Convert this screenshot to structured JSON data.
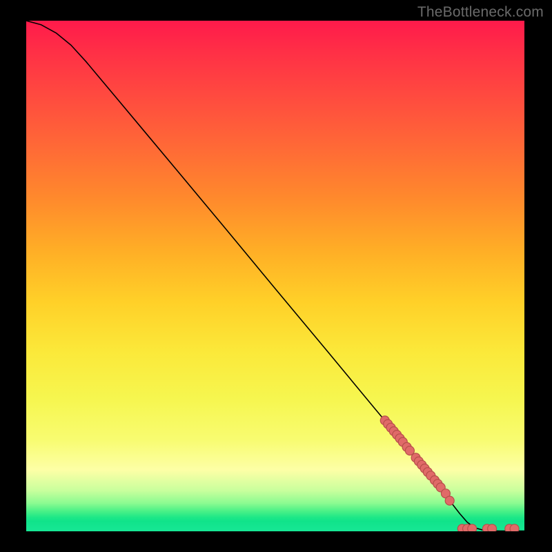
{
  "attribution": "TheBottleneck.com",
  "chart_data": {
    "type": "line",
    "title": "",
    "xlabel": "",
    "ylabel": "",
    "xlim": [
      0,
      100
    ],
    "ylim": [
      0,
      100
    ],
    "grid": false,
    "legend": false,
    "curve": [
      {
        "x": 0,
        "y": 100
      },
      {
        "x": 3,
        "y": 99.2
      },
      {
        "x": 6,
        "y": 97.6
      },
      {
        "x": 9,
        "y": 95.2
      },
      {
        "x": 12,
        "y": 92.0
      },
      {
        "x": 15,
        "y": 88.5
      },
      {
        "x": 18,
        "y": 85.0
      },
      {
        "x": 24,
        "y": 78.0
      },
      {
        "x": 30,
        "y": 71.0
      },
      {
        "x": 40,
        "y": 59.3
      },
      {
        "x": 50,
        "y": 47.5
      },
      {
        "x": 60,
        "y": 35.8
      },
      {
        "x": 70,
        "y": 24.0
      },
      {
        "x": 76,
        "y": 17.0
      },
      {
        "x": 80,
        "y": 12.3
      },
      {
        "x": 83,
        "y": 8.8
      },
      {
        "x": 85,
        "y": 6.0
      },
      {
        "x": 87,
        "y": 3.5
      },
      {
        "x": 88.5,
        "y": 1.8
      },
      {
        "x": 90,
        "y": 0.7
      },
      {
        "x": 92,
        "y": 0.15
      },
      {
        "x": 95,
        "y": 0.05
      },
      {
        "x": 100,
        "y": 0.05
      }
    ],
    "points": [
      {
        "x": 72.0,
        "y": 21.7
      },
      {
        "x": 72.6,
        "y": 21.0
      },
      {
        "x": 73.2,
        "y": 20.3
      },
      {
        "x": 73.8,
        "y": 19.6
      },
      {
        "x": 74.4,
        "y": 18.9
      },
      {
        "x": 75.0,
        "y": 18.2
      },
      {
        "x": 75.6,
        "y": 17.5
      },
      {
        "x": 76.4,
        "y": 16.5
      },
      {
        "x": 77.0,
        "y": 15.8
      },
      {
        "x": 78.2,
        "y": 14.4
      },
      {
        "x": 78.8,
        "y": 13.7
      },
      {
        "x": 79.4,
        "y": 13.0
      },
      {
        "x": 80.0,
        "y": 12.3
      },
      {
        "x": 80.6,
        "y": 11.6
      },
      {
        "x": 81.2,
        "y": 10.9
      },
      {
        "x": 82.0,
        "y": 10.0
      },
      {
        "x": 82.6,
        "y": 9.3
      },
      {
        "x": 83.2,
        "y": 8.6
      },
      {
        "x": 84.2,
        "y": 7.4
      },
      {
        "x": 85.0,
        "y": 6.0
      },
      {
        "x": 87.5,
        "y": 0.5
      },
      {
        "x": 88.5,
        "y": 0.5
      },
      {
        "x": 89.5,
        "y": 0.5
      },
      {
        "x": 92.5,
        "y": 0.5
      },
      {
        "x": 93.5,
        "y": 0.5
      },
      {
        "x": 97.0,
        "y": 0.5
      },
      {
        "x": 98.0,
        "y": 0.5
      }
    ],
    "colors": {
      "curve": "#000000",
      "point_fill": "#e06a68",
      "point_stroke": "#b64e4a",
      "gradient_top": "#ff1a4b",
      "gradient_bottom": "#17e795"
    }
  }
}
